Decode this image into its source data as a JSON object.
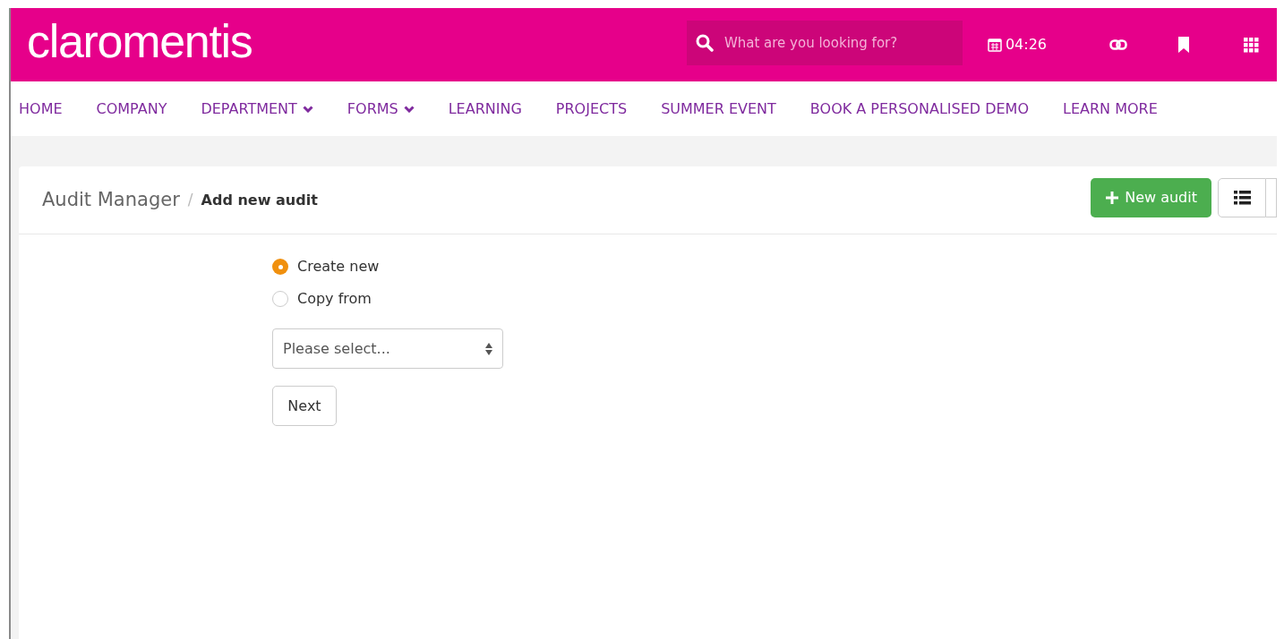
{
  "header": {
    "logo": "claromentis",
    "search": {
      "placeholder": "What are you looking for?"
    },
    "time": "04:26"
  },
  "nav": [
    {
      "label": "HOME",
      "dropdown": false
    },
    {
      "label": "COMPANY",
      "dropdown": false
    },
    {
      "label": "DEPARTMENT",
      "dropdown": true
    },
    {
      "label": "FORMS",
      "dropdown": true
    },
    {
      "label": "LEARNING",
      "dropdown": false
    },
    {
      "label": "PROJECTS",
      "dropdown": false
    },
    {
      "label": "SUMMER EVENT",
      "dropdown": false
    },
    {
      "label": "BOOK A PERSONALISED DEMO",
      "dropdown": false
    },
    {
      "label": "LEARN MORE",
      "dropdown": false
    }
  ],
  "breadcrumb": [
    "Audit Manager",
    "/",
    "Add new audit"
  ],
  "new_button": "New audit",
  "options": [
    {
      "label": "Create new",
      "selected": true
    },
    {
      "label": "Copy from",
      "selected": false
    }
  ],
  "select": {
    "placeholder": "Please select..."
  },
  "next_button": "Next"
}
